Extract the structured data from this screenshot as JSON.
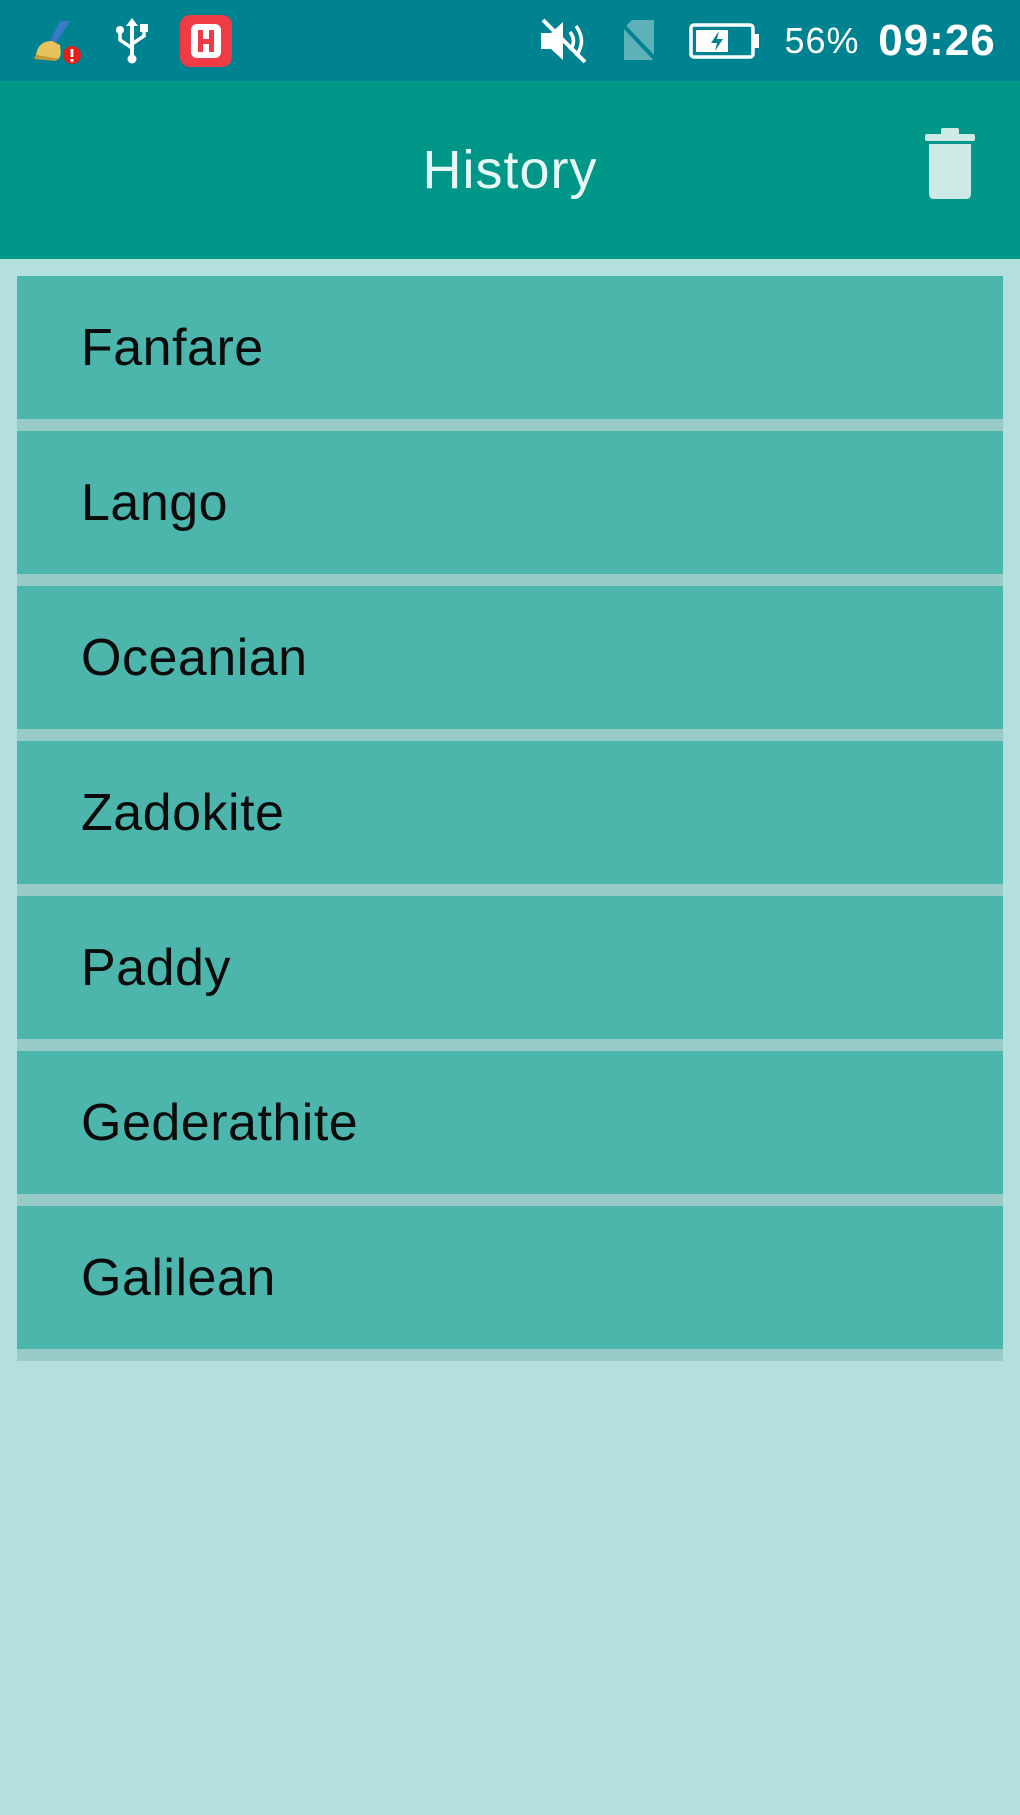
{
  "status_bar": {
    "battery_percent": "56%",
    "time": "09:26",
    "icons": [
      "cleaner-alert-icon",
      "usb-icon",
      "app-notification-icon",
      "mute-icon",
      "no-sim-icon",
      "battery-charging-icon"
    ]
  },
  "app_bar": {
    "title": "History",
    "delete_icon": "trash-icon"
  },
  "history": {
    "items": [
      {
        "label": "Fanfare"
      },
      {
        "label": "Lango"
      },
      {
        "label": "Oceanian"
      },
      {
        "label": "Zadokite"
      },
      {
        "label": "Paddy"
      },
      {
        "label": "Gederathite"
      },
      {
        "label": "Galilean"
      }
    ]
  },
  "colors": {
    "status_bar": "#008390",
    "app_bar": "#009688",
    "list_item": "#4db6ac",
    "divider": "#98cbc7",
    "background": "#b3e0dc"
  }
}
